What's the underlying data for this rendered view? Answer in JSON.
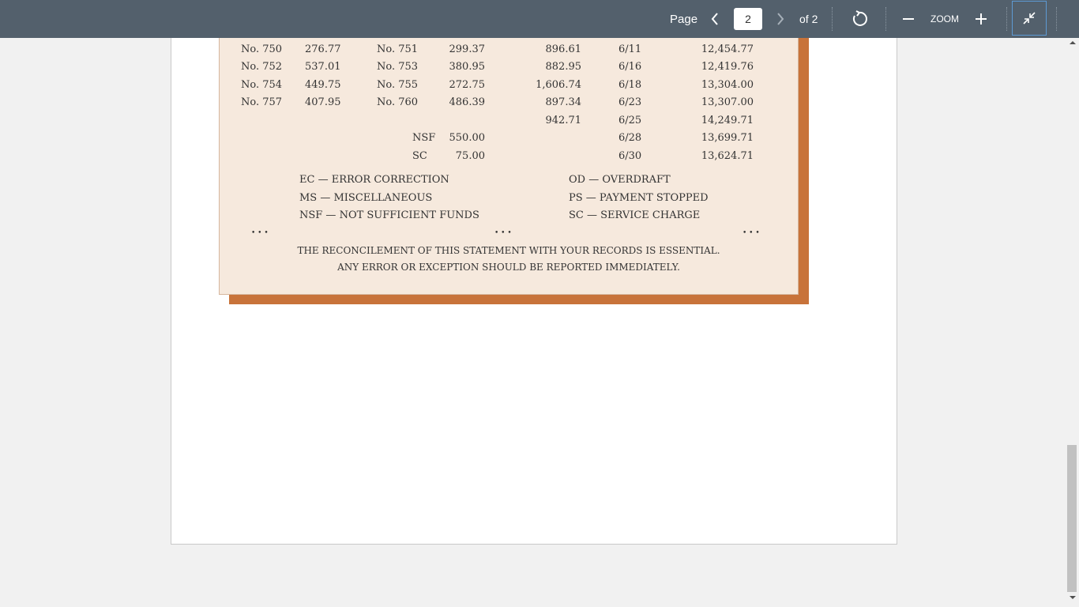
{
  "toolbar": {
    "page_label": "Page",
    "current_page": "2",
    "of_label": "of 2",
    "zoom_label": "ZOOM",
    "icons": {
      "prev": "chevron-left-icon",
      "next": "chevron-right-icon",
      "rotate": "rotate-icon",
      "zoom_out": "minus-icon",
      "zoom_in": "plus-icon",
      "fit": "collapse-arrows-icon"
    },
    "colors": {
      "background": "#53606c",
      "accent": "#5d9ad4"
    }
  },
  "statement": {
    "checks": [
      {
        "no_a": "No. 750",
        "amt_a": "276.77",
        "no_b": "No. 751",
        "amt_b": "299.37",
        "deposit": "896.61",
        "date": "6/11",
        "balance": "12,454.77"
      },
      {
        "no_a": "No. 752",
        "amt_a": "537.01",
        "no_b": "No. 753",
        "amt_b": "380.95",
        "deposit": "882.95",
        "date": "6/16",
        "balance": "12,419.76"
      },
      {
        "no_a": "No. 754",
        "amt_a": "449.75",
        "no_b": "No. 755",
        "amt_b": "272.75",
        "deposit": "1,606.74",
        "date": "6/18",
        "balance": "13,304.00"
      },
      {
        "no_a": "No. 757",
        "amt_a": "407.95",
        "no_b": "No. 760",
        "amt_b": "486.39",
        "deposit": "897.34",
        "date": "6/23",
        "balance": "13,307.00"
      }
    ],
    "extra_rows": [
      {
        "code": "",
        "amount": "",
        "deposit": "942.71",
        "date": "6/25",
        "balance": "14,249.71"
      },
      {
        "code": "NSF",
        "amount": "550.00",
        "deposit": "",
        "date": "6/28",
        "balance": "13,699.71"
      },
      {
        "code": "SC",
        "amount": "75.00",
        "deposit": "",
        "date": "6/30",
        "balance": "13,624.71"
      }
    ],
    "legend_left": [
      "EC — ERROR CORRECTION",
      "MS — MISCELLANEOUS",
      "NSF — NOT SUFFICIENT FUNDS"
    ],
    "legend_right": [
      "OD — OVERDRAFT",
      "PS — PAYMENT STOPPED",
      "SC — SERVICE CHARGE"
    ],
    "dots": "• • •",
    "footer_line1": "THE RECONCILEMENT OF THIS STATEMENT WITH YOUR RECORDS IS ESSENTIAL.",
    "footer_line2": "ANY ERROR OR EXCEPTION SHOULD BE REPORTED IMMEDIATELY.",
    "colors": {
      "paper": "#f6e9dd",
      "border": "#c8733a"
    }
  },
  "scrollbar": {
    "position": 0.75
  }
}
